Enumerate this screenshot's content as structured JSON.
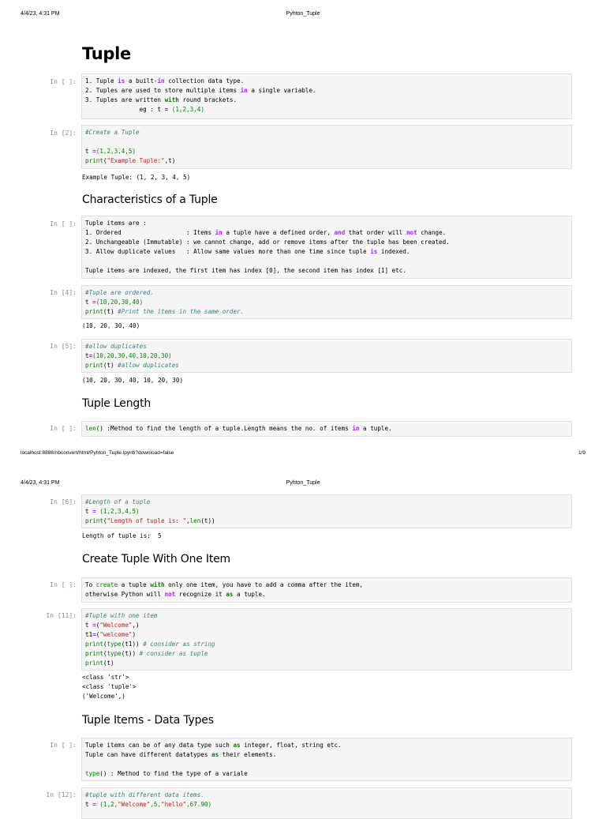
{
  "page1": {
    "header_date": "4/4/23, 4:31 PM",
    "header_title": "Pyhton_Tuple",
    "footer_url": "localhost:8888/nbconvert/html/Pyhton_Tuple.ipynb?download=false",
    "footer_page": "1/9",
    "title": "Tuple",
    "cell1": {
      "prompt": "In [ ]:",
      "l1a": "1. Tuple ",
      "l1b": "is",
      "l1c": " a built-",
      "l1d": "in",
      "l1e": " collection data type.",
      "l2a": "2. Tuples are used to store multiple items ",
      "l2b": "in",
      "l2c": " a single variable.",
      "l3a": "3. Tuples are written ",
      "l3b": "with",
      "l3c": " round brackets.",
      "l4a": "               eg : t ",
      "l4b": "=",
      "l4c": " (1,2,3,4)"
    },
    "cell2": {
      "prompt": "In [2]:",
      "comment": "#Create a Tuple",
      "l2a": "t ",
      "l2b": "=",
      "l2c": "(1,2,3,4,5)",
      "l3a": "print",
      "l3b": "(",
      "l3c": "\"Example Tuple:\"",
      "l3d": ",t)",
      "output": "Example Tuple: (1, 2, 3, 4, 5)"
    },
    "h_char": "Characteristics of a Tuple",
    "cell3": {
      "prompt": "In [ ]:",
      "l1": "Tuple items are :",
      "l2a": "1. Ordered                  : Items ",
      "l2b": "in",
      "l2c": " a tuple have a defined order, ",
      "l2d": "and",
      "l2e": " that order will ",
      "l2f": "not",
      "l2g": " change.",
      "l3": "2. Unchangeable (Immutable) : we cannot change, add or remove items after the tuple has been created.",
      "l4a": "3. Allow duplicate values   : Allow same values more than one time since tuple ",
      "l4b": "is",
      "l4c": " indexed.",
      "l6": "Tuple items are indexed, the first item has index [0], the second item has index [1] etc."
    },
    "cell4": {
      "prompt": "In [4]:",
      "comment": "#Tuple are ordered.",
      "l2a": "t ",
      "l2b": "=",
      "l2c": "(10,20,30,40)",
      "l3a": "print",
      "l3b": "(t) ",
      "l3c": "#Print the items in the same order.",
      "output": "(10, 20, 30, 40)"
    },
    "cell5": {
      "prompt": "In [5]:",
      "comment": "#allow duplicates",
      "l2a": "t",
      "l2b": "=",
      "l2c": "(10,20,30,40,10,20,30)",
      "l3a": "print",
      "l3b": "(t) ",
      "l3c": "#allow duplicates",
      "output": "(10, 20, 30, 40, 10, 20, 30)"
    },
    "h_len": "Tuple Length",
    "cell6": {
      "prompt": "In [ ]:",
      "l1a": "len",
      "l1b": "() :Method to find the length of a tuple.Length means the no. of items ",
      "l1c": "in",
      "l1d": " a tuple."
    }
  },
  "page2": {
    "header_date": "4/4/23, 4:31 PM",
    "header_title": "Pyhton_Tuple",
    "cell7": {
      "prompt": "In [6]:",
      "comment": "#Length of a tuple",
      "l2a": "t ",
      "l2b": "=",
      "l2c": " (1,2,3,4,5)",
      "l3a": "print",
      "l3b": "(",
      "l3c": "\"Length of tuple is: \"",
      "l3d": ",",
      "l3e": "len",
      "l3f": "(t))",
      "output": "Length of tuple is:  5"
    },
    "h_one": "Create Tuple With One Item",
    "cell8": {
      "prompt": "In [ ]:",
      "l1a": "To ",
      "l1b": "create",
      "l1c": " a tuple ",
      "l1d": "with",
      "l1e": " only one item, you have to add a comma after the item,",
      "l2a": "otherwise Python will ",
      "l2b": "not",
      "l2c": " recognize it ",
      "l2d": "as",
      "l2e": " a tuple."
    },
    "cell9": {
      "prompt": "In [11]:",
      "comment": "#Tuple with one item",
      "l2a": "t ",
      "l2b": "=",
      "l2c": "(",
      "l2d": "\"Welcome\"",
      "l2e": ",)",
      "l3a": "t1",
      "l3b": "=",
      "l3c": "(",
      "l3d": "\"welcome\"",
      "l3e": ")",
      "l4a": "print",
      "l4b": "(",
      "l4c": "type",
      "l4d": "(t1)) ",
      "l4e": "# consider as string",
      "l5a": "print",
      "l5b": "(",
      "l5c": "type",
      "l5d": "(t)) ",
      "l5e": "# consider as tuple",
      "l6a": "print",
      "l6b": "(t)",
      "out1": "<class 'str'>",
      "out2": "<class 'tuple'>",
      "out3": "('Welcome',)"
    },
    "h_types": "Tuple Items - Data Types",
    "cell10": {
      "prompt": "In [ ]:",
      "l1a": "Tuple items can be of any data type such ",
      "l1b": "as",
      "l1c": " integer, float, string etc.",
      "l2a": "Tuple can have different datatypes ",
      "l2b": "as",
      "l2c": " their elements.",
      "l4a": "type",
      "l4b": "() : Method to find the type of a variale"
    },
    "cell11": {
      "prompt": "In [12]:",
      "comment": "#tuple with different data items.",
      "l2a": "t ",
      "l2b": "=",
      "l2c": " (1,2,",
      "l2d": "\"Welcome\"",
      "l2e": ",5,",
      "l2f": "\"hello\"",
      "l2g": ",67.90)"
    }
  }
}
